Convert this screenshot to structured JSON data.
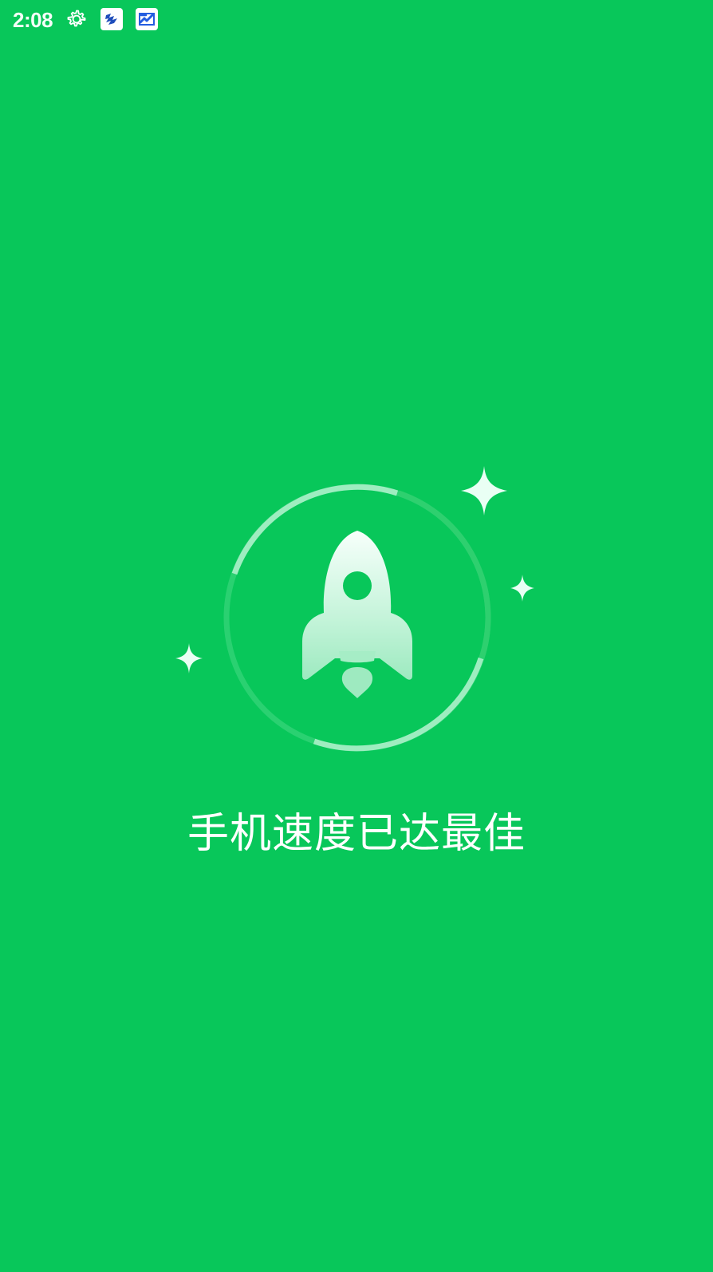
{
  "status_bar": {
    "time": "2:08",
    "icons": [
      "gear-icon",
      "app-notification-icon",
      "app-notification-icon"
    ]
  },
  "main": {
    "message": "手机速度已达最佳",
    "progress": {
      "percent": 100
    }
  },
  "colors": {
    "background": "#08C75A",
    "foreground": "#FFFFFF",
    "ring_track": "#7BE3A3",
    "accent_mint": "#A8F0CA"
  }
}
